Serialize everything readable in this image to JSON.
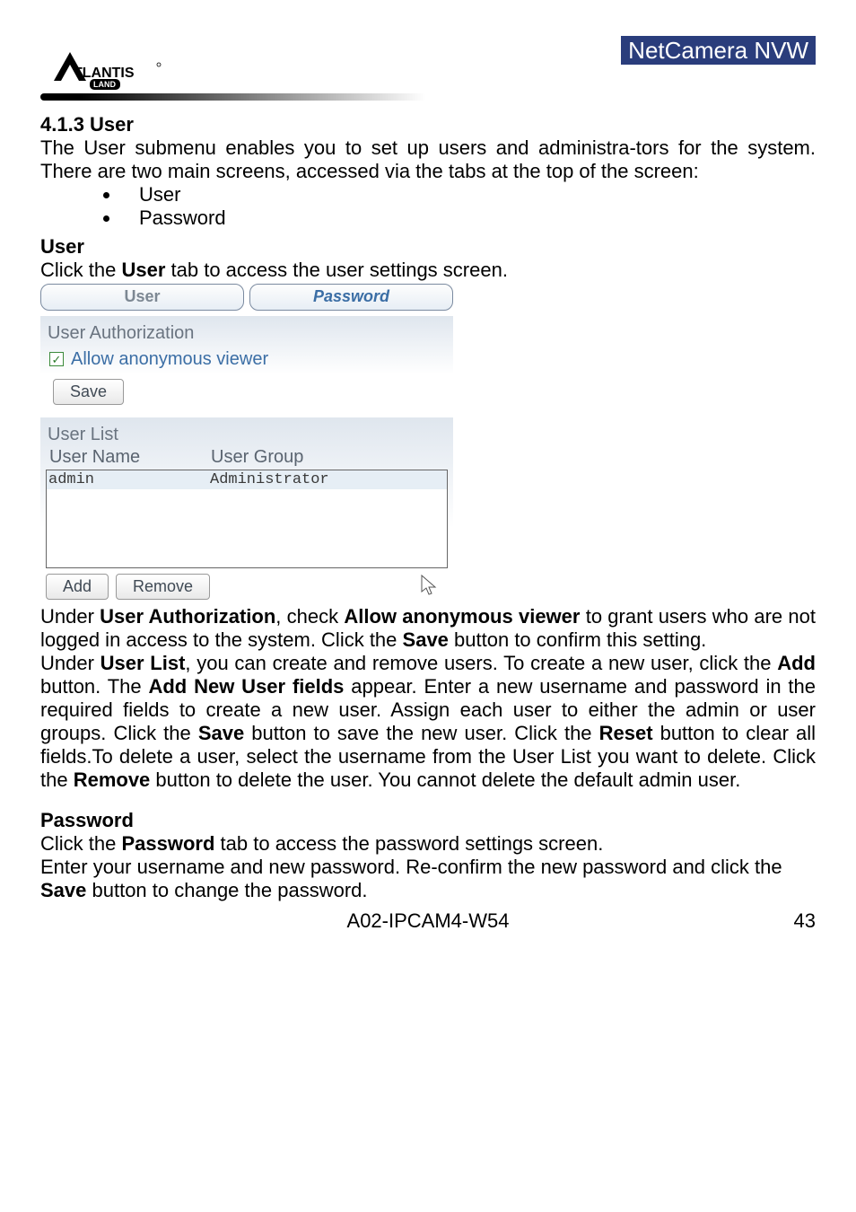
{
  "header": {
    "logo_text": "ATLANTIS",
    "logo_sub": "LAND",
    "product_name": "NetCamera NVW"
  },
  "doc": {
    "section_number": "4.1.3 User",
    "intro_p1": "The User submenu enables you to set up users and administra-tors for the system. There are two main screens, accessed via the tabs at the top of the screen:",
    "bullet1": "User",
    "bullet2": "Password",
    "user_heading": "User",
    "user_line_pre": "Click the ",
    "user_line_bold": "User",
    "user_line_post": " tab to access the user settings screen.",
    "ua_p1a": "Under ",
    "ua_p1b": "User Authorization",
    "ua_p1c": ", check ",
    "ua_p1d": "Allow anonymous viewer",
    "ua_p1e": " to grant users who are not logged in access to the system. Click the  ",
    "ua_p1f": "Save",
    "ua_p1g": " button to confirm this setting.",
    "ul_p_a": "Under ",
    "ul_p_b": "User List",
    "ul_p_c": ", you can create and remove users. To create a new user, click the ",
    "ul_p_d": "Add",
    "ul_p_e": " button. The ",
    "ul_p_f": "Add New User fields",
    "ul_p_g": " appear. Enter a new username and password in the required fields to create a new user. Assign each user to either the admin or user groups. Click the  ",
    "ul_p_h": "Save",
    "ul_p_i": " button to save the new user. Click the ",
    "ul_p_j": "Reset",
    "ul_p_k": "  button to clear all fields.To delete a user, select the username from the User List you want to delete. Click the  ",
    "ul_p_l": "Remove",
    "ul_p_m": " button to delete the user. You cannot delete the default admin user.",
    "pw_heading": "Password",
    "pw_l1a": "Click the ",
    "pw_l1b": "Password",
    "pw_l1c": " tab to access the password settings screen.",
    "pw_l2a": "Enter your username and new password. Re-confirm the new password and click the ",
    "pw_l2b": "Save",
    "pw_l2c": " button to change the password."
  },
  "ui": {
    "tabs": {
      "user": "User",
      "password": "Password"
    },
    "ua_title": "User Authorization",
    "allow_anon": "Allow anonymous viewer",
    "save_btn": "Save",
    "list_title": "User List",
    "col_name": "User Name",
    "col_group": "User Group",
    "rows": [
      {
        "name": "admin",
        "group": "Administrator"
      }
    ],
    "add_btn": "Add",
    "remove_btn": "Remove"
  },
  "footer": {
    "doc_code": "A02-IPCAM4-W54",
    "page": "43"
  }
}
